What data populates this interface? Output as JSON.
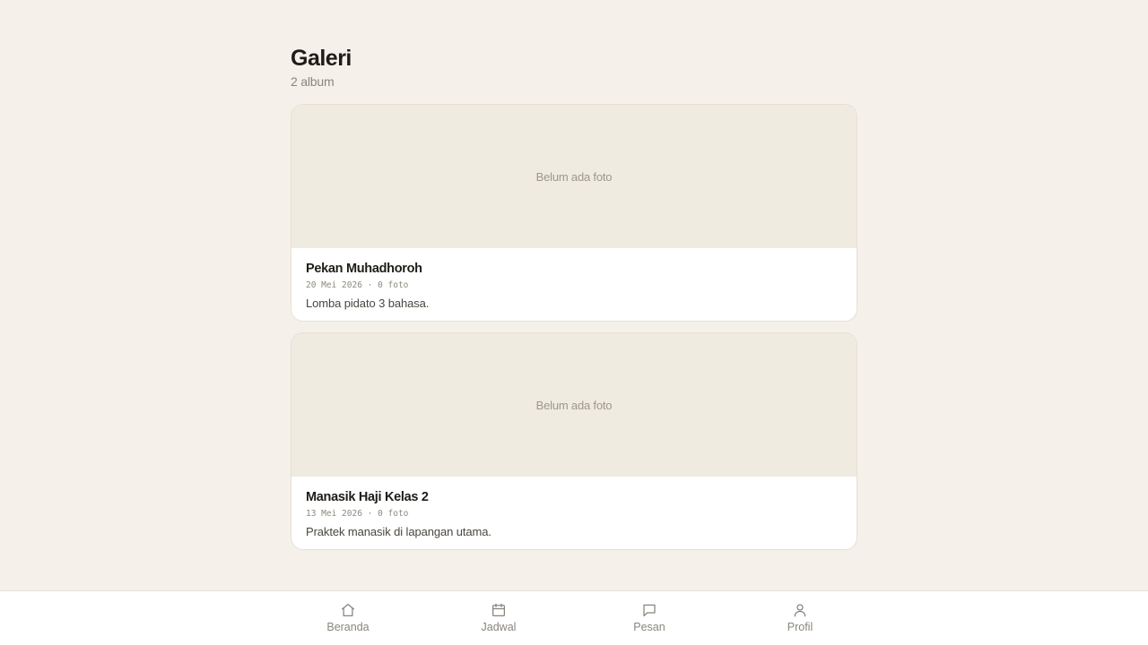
{
  "header": {
    "title": "Galeri",
    "subtitle": "2 album"
  },
  "albums": [
    {
      "empty_label": "Belum ada foto",
      "title": "Pekan Muhadhoroh",
      "meta": "20 Mei 2026 · 0 foto",
      "description": "Lomba pidato 3 bahasa."
    },
    {
      "empty_label": "Belum ada foto",
      "title": "Manasik Haji Kelas 2",
      "meta": "13 Mei 2026 · 0 foto",
      "description": "Praktek manasik di lapangan utama."
    }
  ],
  "nav": {
    "items": [
      {
        "label": "Beranda",
        "icon": "home-icon"
      },
      {
        "label": "Jadwal",
        "icon": "calendar-icon"
      },
      {
        "label": "Pesan",
        "icon": "message-icon"
      },
      {
        "label": "Profil",
        "icon": "user-icon"
      }
    ]
  },
  "colors": {
    "background": "#f5f1ea",
    "card_cover": "#efebe0",
    "text_primary": "#1f1c17",
    "text_muted": "#8a857c"
  }
}
